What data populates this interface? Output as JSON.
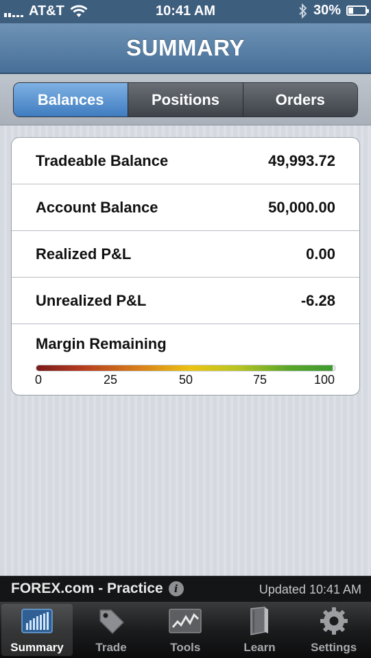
{
  "status_bar": {
    "carrier": "AT&T",
    "time": "10:41 AM",
    "battery": "30%",
    "battery_level": 0.3,
    "icons": [
      "signal-bars-icon",
      "wifi-icon",
      "bluetooth-icon",
      "battery-icon"
    ]
  },
  "header": {
    "title": "SUMMARY"
  },
  "segments": [
    {
      "label": "Balances",
      "active": true
    },
    {
      "label": "Positions",
      "active": false
    },
    {
      "label": "Orders",
      "active": false
    }
  ],
  "balances": [
    {
      "label": "Tradeable Balance",
      "value": "49,993.72"
    },
    {
      "label": "Account Balance",
      "value": "50,000.00"
    },
    {
      "label": "Realized P&L",
      "value": "0.00"
    },
    {
      "label": "Unrealized P&L",
      "value": "-6.28"
    }
  ],
  "margin": {
    "title": "Margin Remaining",
    "level_percent": 99,
    "ticks": [
      "0",
      "25",
      "50",
      "75",
      "100"
    ]
  },
  "footer": {
    "brand": "FOREX.com - Practice",
    "updated": "Updated 10:41 AM"
  },
  "tabs": [
    {
      "label": "Summary",
      "icon": "bar-chart-icon",
      "active": true
    },
    {
      "label": "Trade",
      "icon": "tag-icon",
      "active": false
    },
    {
      "label": "Tools",
      "icon": "line-chart-icon",
      "active": false
    },
    {
      "label": "Learn",
      "icon": "book-icon",
      "active": false
    },
    {
      "label": "Settings",
      "icon": "gear-icon",
      "active": false
    }
  ],
  "colors": {
    "header": "#476f97",
    "segment_active": "#3f7cc0",
    "tabbar": "#1b1c1d"
  }
}
